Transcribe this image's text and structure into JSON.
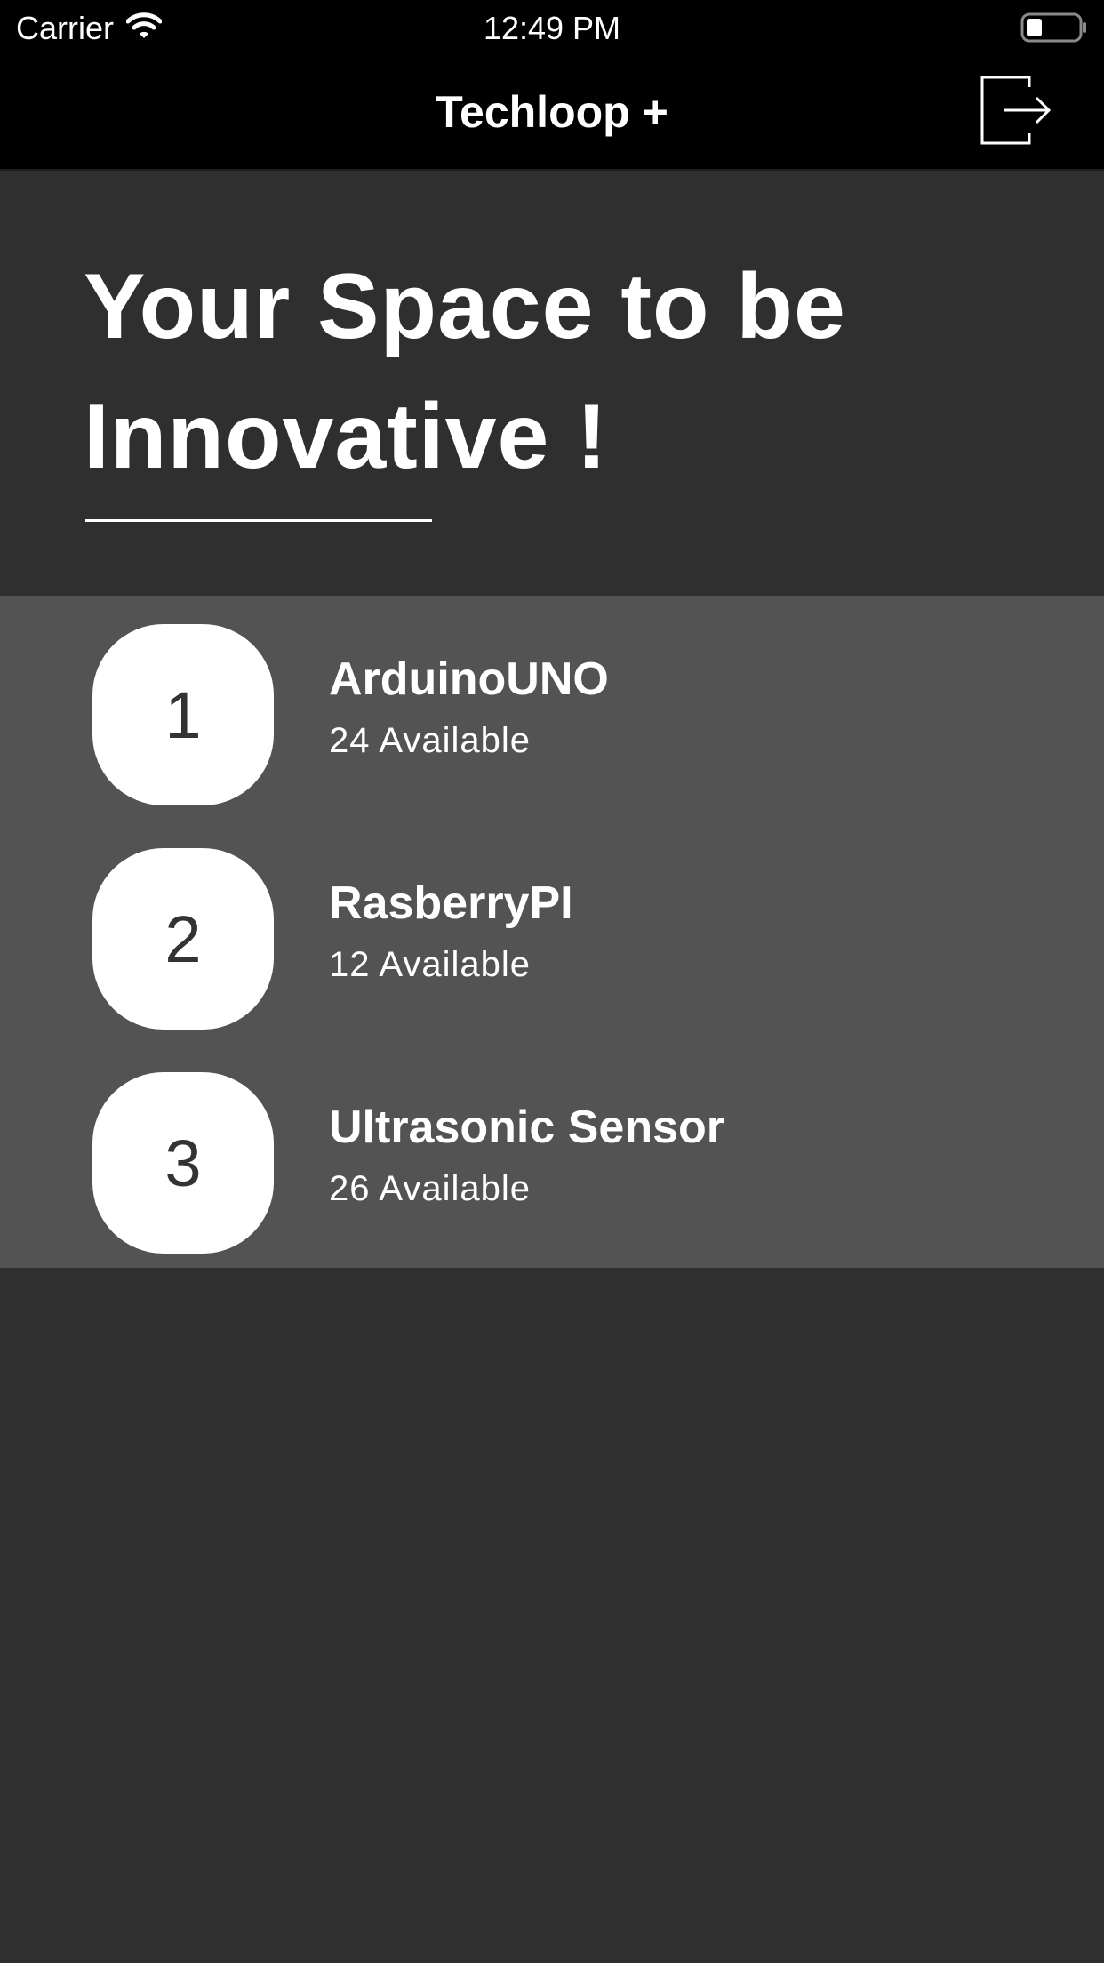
{
  "status_bar": {
    "carrier": "Carrier",
    "time": "12:49 PM"
  },
  "nav": {
    "title": "Techloop +"
  },
  "hero": {
    "title_line1": "Your Space to be",
    "title_line2": "Innovative !"
  },
  "items": [
    {
      "index": "1",
      "name": "ArduinoUNO",
      "available": "24 Available"
    },
    {
      "index": "2",
      "name": "RasberryPI",
      "available": "12 Available"
    },
    {
      "index": "3",
      "name": "Ultrasonic Sensor",
      "available": "26 Available"
    }
  ],
  "icons": {
    "wifi": "wifi-icon",
    "battery": "battery-icon",
    "logout": "logout-icon"
  },
  "colors": {
    "nav_background": "#000000",
    "page_background": "#2f2f2f",
    "list_background": "#535353",
    "badge_background": "#ffffff",
    "badge_text": "#333333",
    "text": "#ffffff"
  }
}
